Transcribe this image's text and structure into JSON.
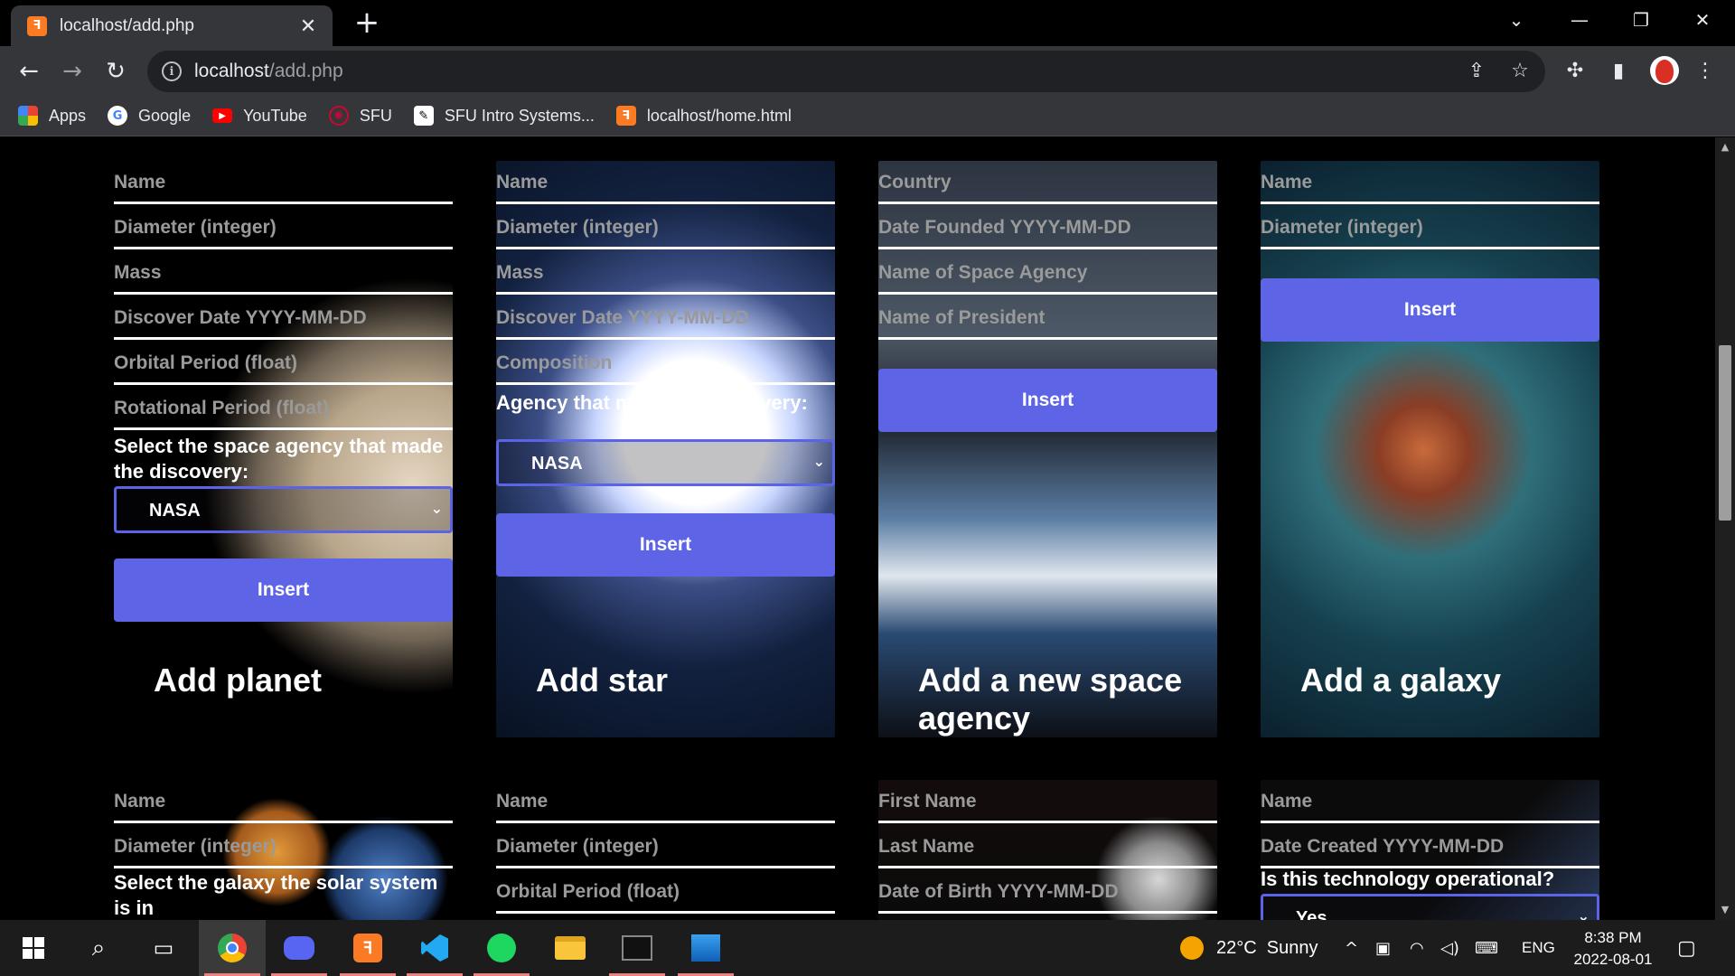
{
  "browser": {
    "tab_title": "localhost/add.php",
    "url_host": "localhost",
    "url_path": "/add.php",
    "bookmarks": [
      {
        "label": "Apps",
        "icon": "apps-grid-icon"
      },
      {
        "label": "Google",
        "icon": "google-icon"
      },
      {
        "label": "YouTube",
        "icon": "youtube-icon"
      },
      {
        "label": "SFU",
        "icon": "sfu-icon"
      },
      {
        "label": "SFU Intro Systems...",
        "icon": "sfu-systems-icon"
      },
      {
        "label": "localhost/home.html",
        "icon": "xampp-icon"
      }
    ]
  },
  "cards": {
    "planet": {
      "fields": [
        "Name",
        "Diameter (integer)",
        "Mass",
        "Discover Date YYYY-MM-DD",
        "Orbital Period (float)",
        "Rotational Period (float)"
      ],
      "select_label": "Select the space agency that made the discovery:",
      "select_value": "NASA",
      "insert": "Insert",
      "title": "Add planet"
    },
    "star": {
      "fields": [
        "Name",
        "Diameter (integer)",
        "Mass",
        "Discover Date YYYY-MM-DD",
        "Composition"
      ],
      "select_label": "Agency that made the discovery:",
      "select_value": "NASA",
      "insert": "Insert",
      "title": "Add star"
    },
    "agency": {
      "fields": [
        "Country",
        "Date Founded YYYY-MM-DD",
        "Name of Space Agency",
        "Name of President"
      ],
      "insert": "Insert",
      "title": "Add a new space agency"
    },
    "galaxy": {
      "fields": [
        "Name",
        "Diameter (integer)"
      ],
      "insert": "Insert",
      "title": "Add a galaxy"
    },
    "solar": {
      "fields": [
        "Name",
        "Diameter (integer)"
      ],
      "select_label": "Select the galaxy the solar system is in"
    },
    "moon": {
      "fields": [
        "Name",
        "Diameter (integer)",
        "Orbital Period (float)"
      ]
    },
    "astronaut": {
      "fields": [
        "First Name",
        "Last Name",
        "Date of Birth YYYY-MM-DD"
      ]
    },
    "technology": {
      "fields": [
        "Name",
        "Date Created YYYY-MM-DD"
      ],
      "select_label": "Is this technology operational?",
      "select_value": "Yes"
    }
  },
  "taskbar": {
    "weather": "22°C  Sunny",
    "language": "ENG",
    "time": "8:38 PM",
    "date": "2022-08-01"
  },
  "colors": {
    "accent": "#5d64e6",
    "chrome_dark": "#35363a"
  }
}
